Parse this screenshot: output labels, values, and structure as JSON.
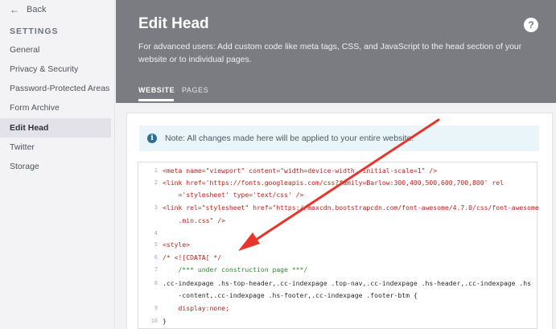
{
  "sidebar": {
    "back_label": "Back",
    "section_title": "SETTINGS",
    "items": [
      {
        "label": "General"
      },
      {
        "label": "Privacy & Security"
      },
      {
        "label": "Password-Protected Areas"
      },
      {
        "label": "Form Archive"
      },
      {
        "label": "Edit Head",
        "active": true
      },
      {
        "label": "Twitter"
      },
      {
        "label": "Storage"
      }
    ]
  },
  "header": {
    "title": "Edit Head",
    "description": "For advanced users: Add custom code like meta tags, CSS, and JavaScript to the head section of your website or to individual pages.",
    "help_symbol": "?",
    "tabs": [
      {
        "label": "WEBSITE",
        "active": true
      },
      {
        "label": "PAGES"
      }
    ]
  },
  "note": {
    "icon": "info-icon",
    "text": "Note: All changes made here will be applied to your entire website."
  },
  "editor": {
    "lines": [
      {
        "n": "1",
        "text": "<meta name=\"viewport\" content=\"width=device-width, initial-scale=1\" />"
      },
      {
        "n": "2",
        "text": "<link href='https://fonts.googleapis.com/css?family=Barlow:300,400,500,600,700,800' rel"
      },
      {
        "n": "",
        "text": "    ='stylesheet' type='text/css' />"
      },
      {
        "n": "3",
        "text": "<link rel=\"stylesheet\" href=\"https://maxcdn.bootstrapcdn.com/font-awesome/4.7.0/css/font-awesome"
      },
      {
        "n": "",
        "text": "    .min.css\" />"
      },
      {
        "n": "4",
        "text": ""
      },
      {
        "n": "5",
        "text": "<style>"
      },
      {
        "n": "6",
        "text": "/* <![CDATA[ */"
      },
      {
        "n": "7",
        "text": "    /*** under construction page ***/"
      },
      {
        "n": "8",
        "text": ".cc-indexpage .hs-top-header,.cc-indexpage .top-nav,.cc-indexpage .hs-header,.cc-indexpage .hs"
      },
      {
        "n": "",
        "text": "    -content,.cc-indexpage .hs-footer,.cc-indexpage .footer-btm {"
      },
      {
        "n": "9",
        "text": "    display:none;"
      },
      {
        "n": "10",
        "text": "}"
      }
    ]
  },
  "colors": {
    "header_bg": "#7a7c82",
    "annotation_arrow": "#e8352b",
    "note_bg": "#eaf5fa",
    "code_red": "#b3261e"
  }
}
